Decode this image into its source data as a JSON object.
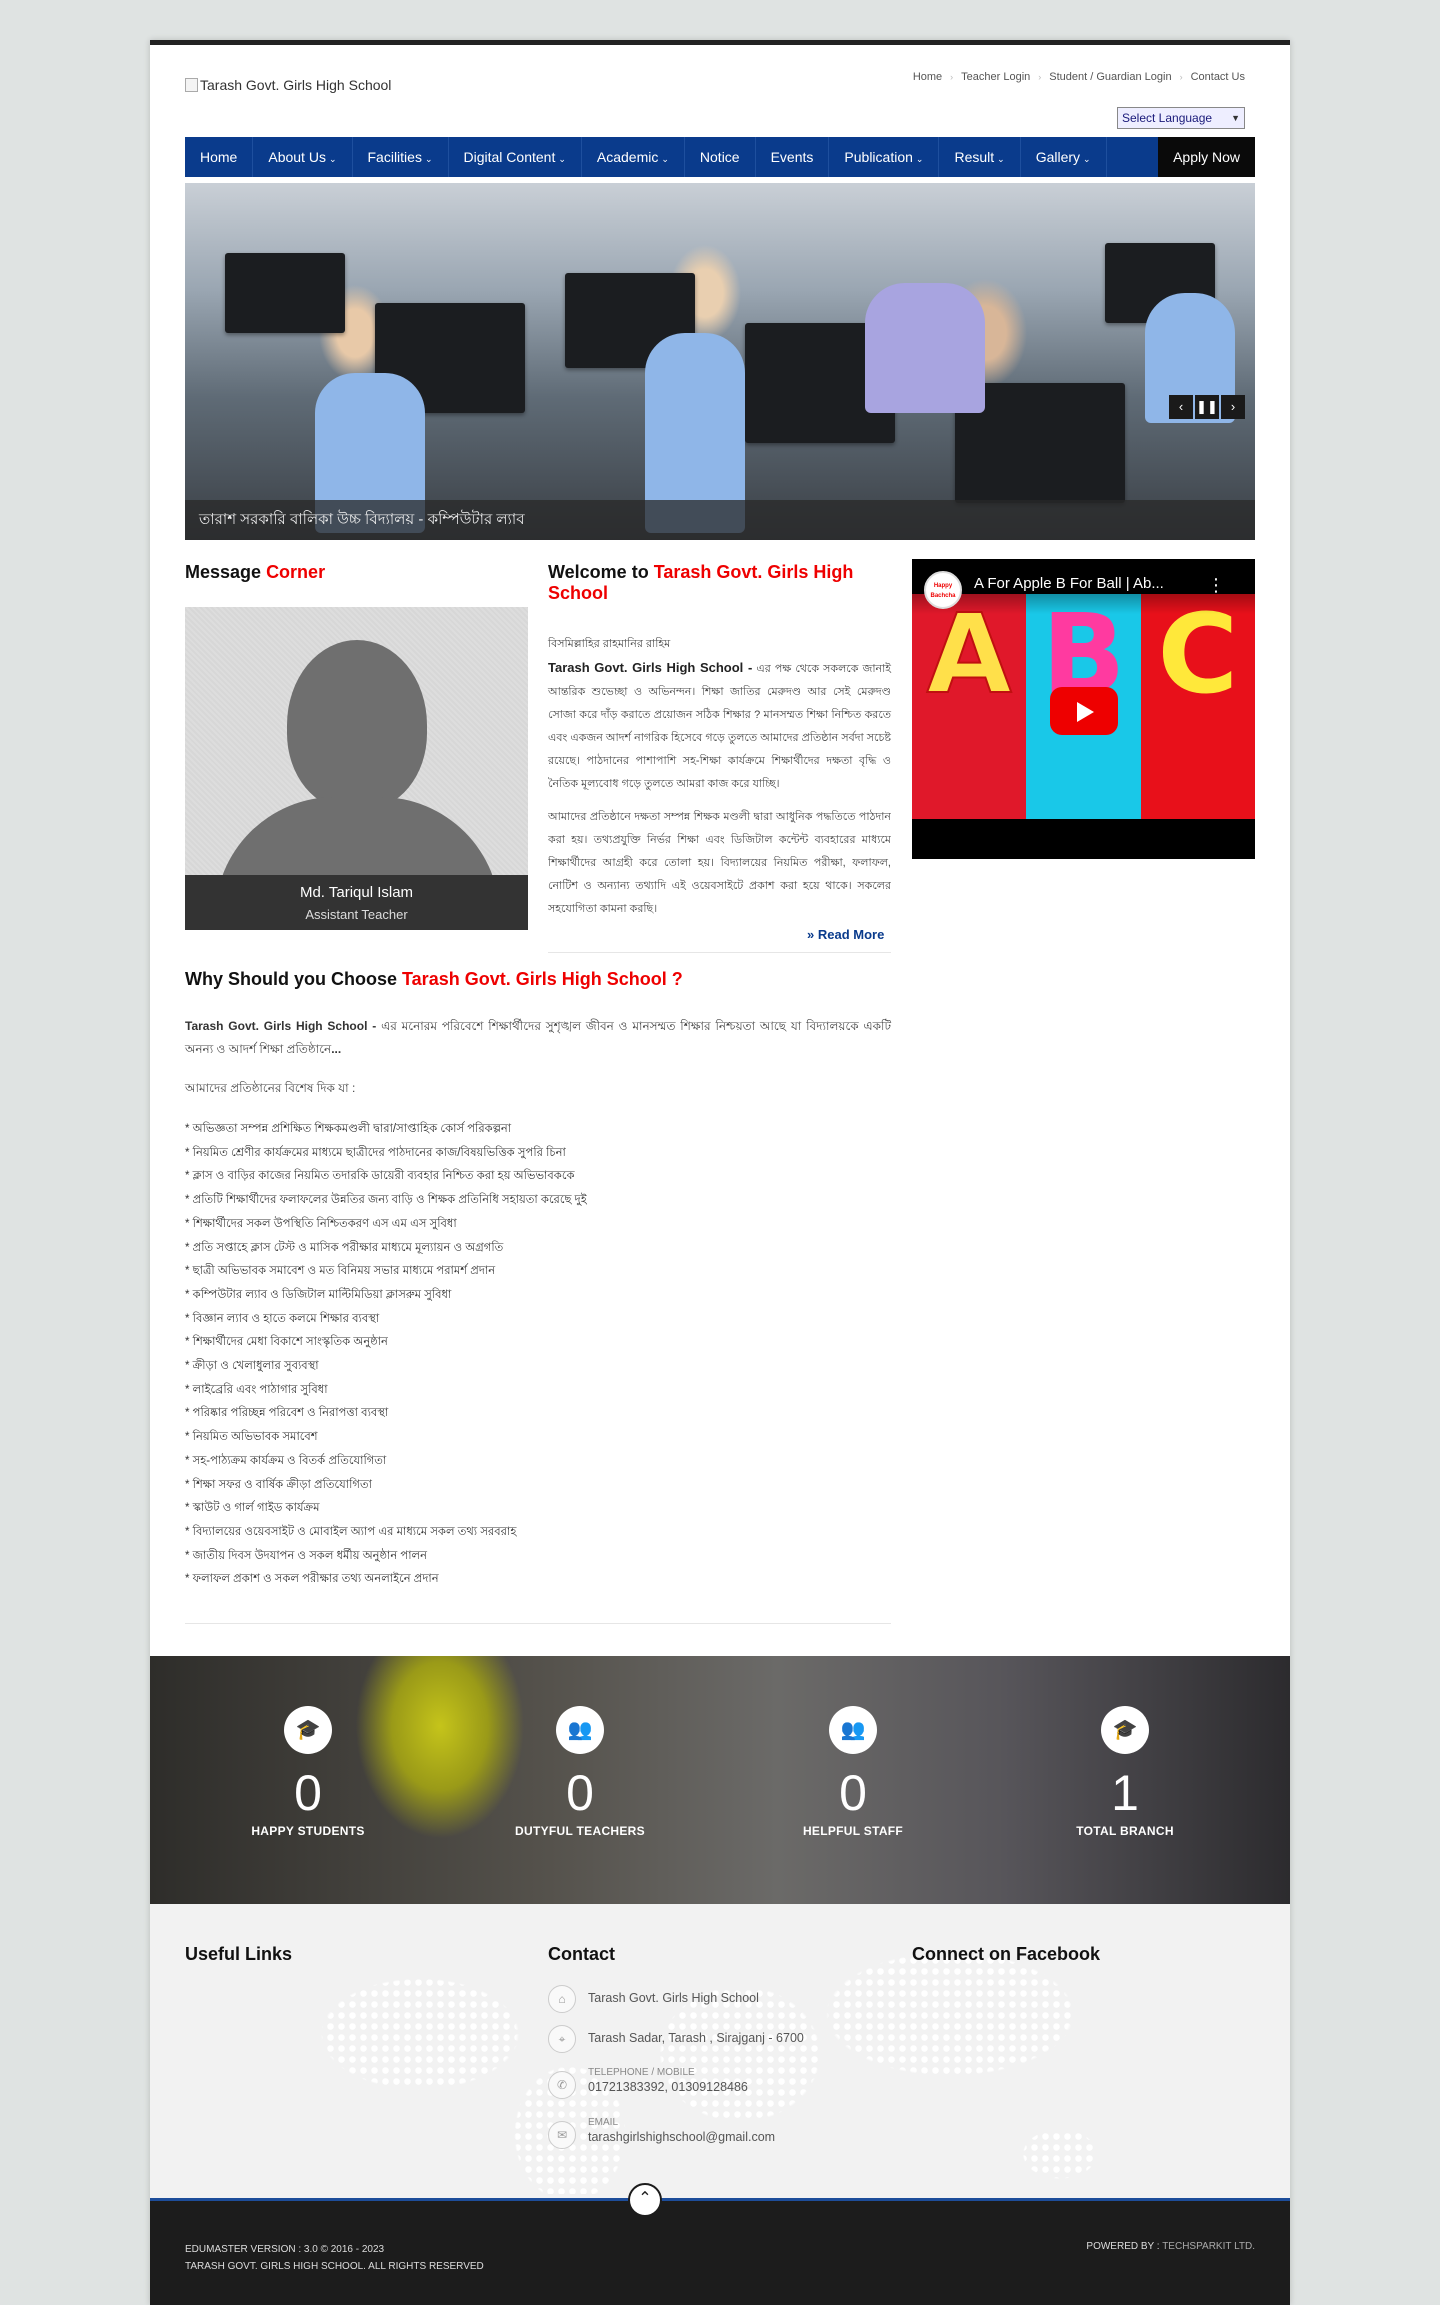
{
  "header": {
    "logo_alt": "Tarash Govt. Girls High School",
    "top_links": [
      "Home",
      "Teacher Login",
      "Student / Guardian Login",
      "Contact Us"
    ],
    "language_select": "Select Language"
  },
  "nav": {
    "items": [
      {
        "label": "Home"
      },
      {
        "label": "About Us"
      },
      {
        "label": "Facilities"
      },
      {
        "label": "Digital Content"
      },
      {
        "label": "Academic"
      },
      {
        "label": "Notice"
      },
      {
        "label": "Events"
      },
      {
        "label": "Publication"
      },
      {
        "label": "Result"
      },
      {
        "label": "Gallery"
      }
    ],
    "apply": "Apply Now"
  },
  "slider": {
    "caption": "তারাশ সরকারি বালিকা উচ্চ বিদ্যালয় - কম্পিউটার ল্যাব"
  },
  "message": {
    "heading": "Message",
    "heading_accent": "Corner",
    "name": "Md. Tariqul Islam",
    "role": "Assistant Teacher"
  },
  "welcome": {
    "heading": "Welcome to",
    "heading_accent": "Tarash Govt. Girls High School",
    "intro_line": "বিসমিল্লাহির রাহমানির রাহিম",
    "school_name": "Tarash Govt. Girls High School -",
    "para1": " এর পক্ষ থেকে সকলকে জানাই আন্তরিক শুভেচ্ছা ও অভিনন্দন। শিক্ষা জাতির মেরুদণ্ড আর সেই মেরুদণ্ড সোজা করে দাঁড় করাতে প্রয়োজন সঠিক শিক্ষার ? মানসম্মত শিক্ষা নিশ্চিত করতে এবং একজন আদর্শ নাগরিক হিসেবে গড়ে তুলতে আমাদের প্রতিষ্ঠান সর্বদা সচেষ্ট রয়েছে। পাঠদানের পাশাপাশি সহ-শিক্ষা কার্যক্রমে শিক্ষার্থীদের দক্ষতা বৃদ্ধি ও নৈতিক মূল্যবোধ গড়ে তুলতে আমরা কাজ করে যাচ্ছি।",
    "para2": "আমাদের প্রতিষ্ঠানে দক্ষতা সম্পন্ন শিক্ষক মণ্ডলী দ্বারা আধুনিক পদ্ধতিতে পাঠদান করা হয়। তথ্যপ্রযুক্তি নির্ভর শিক্ষা এবং ডিজিটাল কন্টেন্ট ব্যবহারের মাধ্যমে শিক্ষার্থীদের আগ্রহী করে তোলা হয়। বিদ্যালয়ের নিয়মিত পরীক্ষা, ফলাফল, নোটিশ ও অন্যান্য তথ্যাদি এই ওয়েবসাইটে প্রকাশ করা হয়ে থাকে। সকলের সহযোগিতা কামনা করছি।",
    "read_more": "Read More"
  },
  "video": {
    "title": "A For Apple B For Ball | Ab...",
    "channel": "Happy Bachcha",
    "letters": [
      "A",
      "B",
      "C"
    ]
  },
  "why": {
    "heading": "Why Should you Choose",
    "heading_accent": "Tarash Govt. Girls High School ?",
    "intro_bold": "Tarash Govt. Girls High School -",
    "intro_text": " এর  মনোরম পরিবেশে শিক্ষার্থীদের সুশৃঙ্খল জীবন ও মানসম্মত শিক্ষার নিশ্চয়তা আছে যা বিদ্যালয়কে একটি অনন্য ও আদর্শ শিক্ষা প্রতিষ্ঠানে",
    "intro_ellipsis": "...",
    "sub": "আমাদের প্রতিষ্ঠানের বিশেষ দিক যা :",
    "list": [
      "* অভিজ্ঞতা সম্পন্ন প্রশিক্ষিত শিক্ষকমণ্ডলী দ্বারা/সাপ্তাহিক কোর্স পরিকল্পনা",
      "* নিয়মিত শ্রেণীর কার্যক্রমের মাধ্যমে ছাত্রীদের পাঠদানের কাজ/বিষয়ভিত্তিক সুপরি চিনা",
      "* ক্লাস ও বাড়ির কাজের নিয়মিত তদারকি ডায়েরী ব্যবহার নিশ্চিত করা হয় অভিভাবককে",
      "* প্রতিটি শিক্ষার্থীদের ফলাফলের উন্নতির জন্য বাড়ি ও শিক্ষক প্রতিনিধি সহায়তা করেছে দুই",
      "* শিক্ষার্থীদের সকল উপস্থিতি নিশ্চিতকরণ এস এম এস সুবিধা",
      "* প্রতি সপ্তাহে ক্লাস টেস্ট ও মাসিক পরীক্ষার মাধ্যমে মূল্যায়ন ও অগ্রগতি",
      "* ছাত্রী অভিভাবক সমাবেশ ও মত বিনিময় সভার মাধ্যমে পরামর্শ প্রদান",
      "* কম্পিউটার ল্যাব ও ডিজিটাল মাল্টিমিডিয়া ক্লাসরুম সুবিধা",
      "* বিজ্ঞান ল্যাব ও হাতে কলমে শিক্ষার ব্যবস্থা",
      "* শিক্ষার্থীদের মেধা বিকাশে সাংস্কৃতিক অনুষ্ঠান",
      "* ক্রীড়া ও খেলাধুলার সুব্যবস্থা",
      "* লাইব্রেরি এবং পাঠাগার সুবিধা",
      "* পরিষ্কার পরিচ্ছন্ন পরিবেশ ও নিরাপত্তা ব্যবস্থা",
      "* নিয়মিত অভিভাবক সমাবেশ",
      "* সহ-পাঠ্যক্রম কার্যক্রম ও বিতর্ক প্রতিযোগিতা",
      "* শিক্ষা সফর ও বার্ষিক ক্রীড়া প্রতিযোগিতা",
      "* স্কাউট ও গার্ল গাইড কার্যক্রম",
      "* বিদ্যালয়ের ওয়েবসাইট ও মোবাইল অ্যাপ এর মাধ্যমে সকল তথ্য সরবরাহ",
      "* জাতীয় দিবস উদযাপন ও সকল ধর্মীয় অনুষ্ঠান পালন",
      "* ফলাফল প্রকাশ ও সকল পরীক্ষার তথ্য অনলাইনে প্রদান"
    ]
  },
  "stats": [
    {
      "icon": "graduation-cap-icon",
      "value": "0",
      "label": "HAPPY STUDENTS"
    },
    {
      "icon": "teachers-icon",
      "value": "0",
      "label": "DUTYFUL TEACHERS"
    },
    {
      "icon": "staff-icon",
      "value": "0",
      "label": "HELPFUL STAFF"
    },
    {
      "icon": "branch-icon",
      "value": "1",
      "label": "TOTAL BRANCH"
    }
  ],
  "footer": {
    "useful_links": "Useful Links",
    "contact_heading": "Contact",
    "facebook_heading": "Connect on Facebook",
    "school": "Tarash Govt. Girls High School",
    "address": "Tarash Sadar, Tarash , Sirajganj - 6700",
    "phone_label": "TELEPHONE / MOBILE",
    "phone": "01721383392, 01309128486",
    "email_label": "EMAIL",
    "email": "tarashgirlshighschool@gmail.com"
  },
  "bottom": {
    "version": "EDUMASTER VERSION : 3.0 © 2016 - 2023",
    "rights": "TARASH GOVT. GIRLS HIGH SCHOOL. ALL RIGHTS RESERVED",
    "powered_label": "POWERED BY :",
    "powered_by": "TECHSPARKIT LTD."
  },
  "colors": {
    "nav": "#0a3b8c",
    "accent": "#e00000",
    "apply": "#0a0a0a"
  }
}
